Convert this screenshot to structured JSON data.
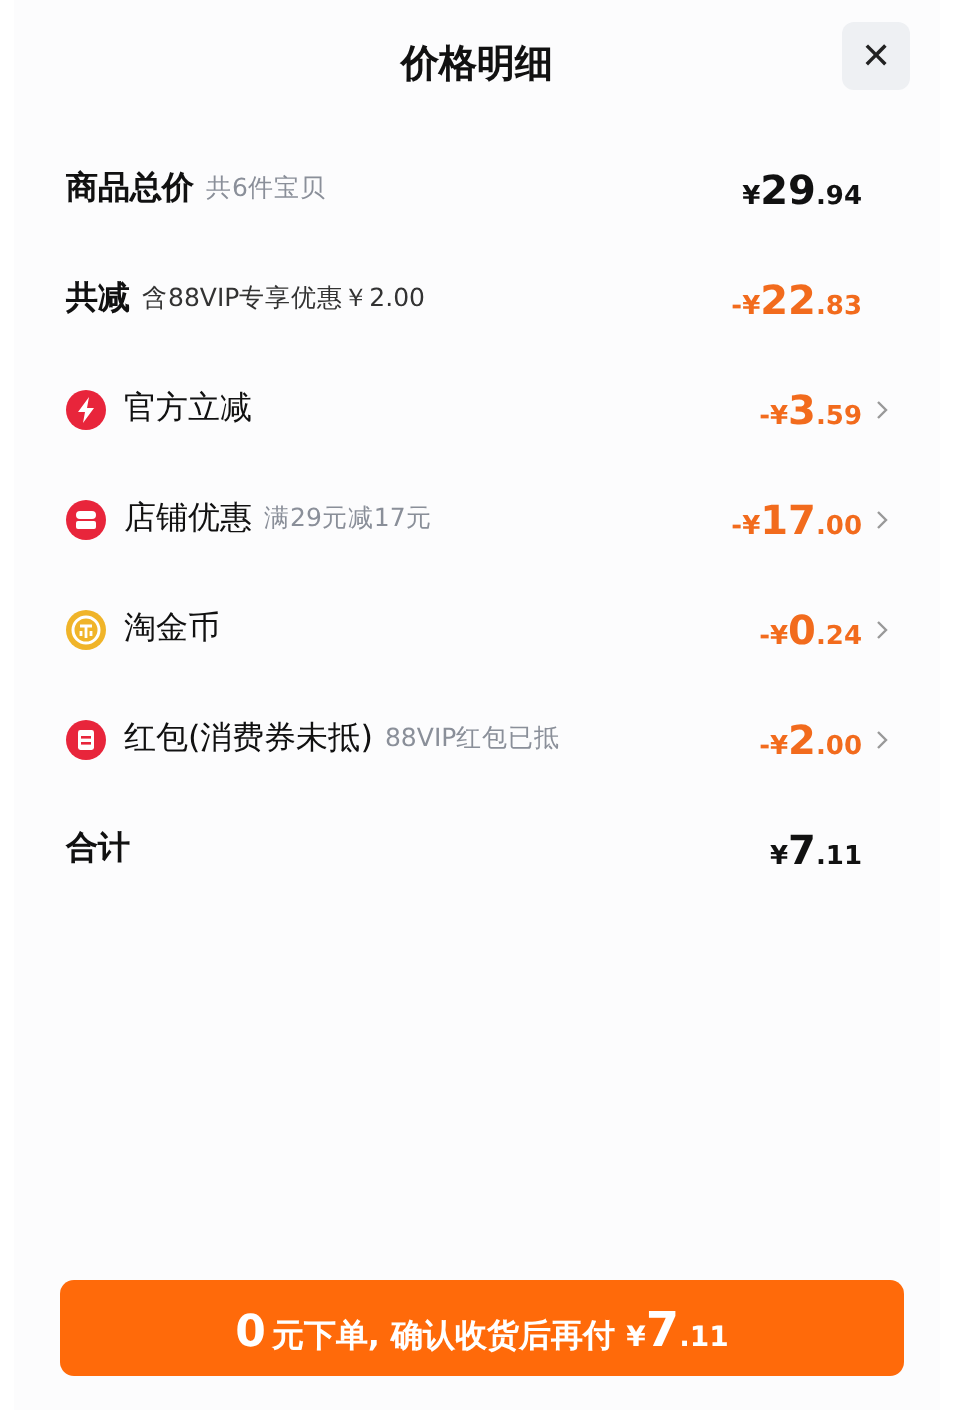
{
  "title": "价格明细",
  "close": "✕",
  "rows": [
    {
      "kind": "subtotal",
      "label": "商品总价",
      "note": "共6件宝贝",
      "amount": {
        "prefix": "¥",
        "whole": "29",
        "fraction": ".94"
      },
      "chevron": false
    },
    {
      "kind": "reduction",
      "label": "共减",
      "note": "含88VIP专享优惠￥2.00",
      "amount": {
        "prefix": "-¥",
        "whole": "22",
        "fraction": ".83"
      },
      "chevron": false
    },
    {
      "kind": "discount",
      "label": "官方立减",
      "amount": {
        "prefix": "-¥",
        "whole": "3",
        "fraction": ".59"
      },
      "chevron": true
    },
    {
      "kind": "discount",
      "label": "店铺优惠",
      "note": "满29元减17元",
      "amount": {
        "prefix": "-¥",
        "whole": "17",
        "fraction": ".00"
      },
      "chevron": true
    },
    {
      "kind": "discount",
      "label": "淘金币",
      "amount": {
        "prefix": "-¥",
        "whole": "0",
        "fraction": ".24"
      },
      "chevron": true
    },
    {
      "kind": "discount",
      "label": "红包(消费券未抵)",
      "note": "88VIP红包已抵",
      "amount": {
        "prefix": "-¥",
        "whole": "2",
        "fraction": ".00"
      },
      "chevron": true
    },
    {
      "kind": "total",
      "label": "合计",
      "amount": {
        "prefix": "¥",
        "whole": "7",
        "fraction": ".11"
      },
      "chevron": false
    }
  ],
  "button": {
    "lead": "0",
    "text": "元下单, 确认收货后再付 ",
    "amount": {
      "prefix": "¥",
      "whole": "7",
      "fraction": ".11"
    }
  }
}
